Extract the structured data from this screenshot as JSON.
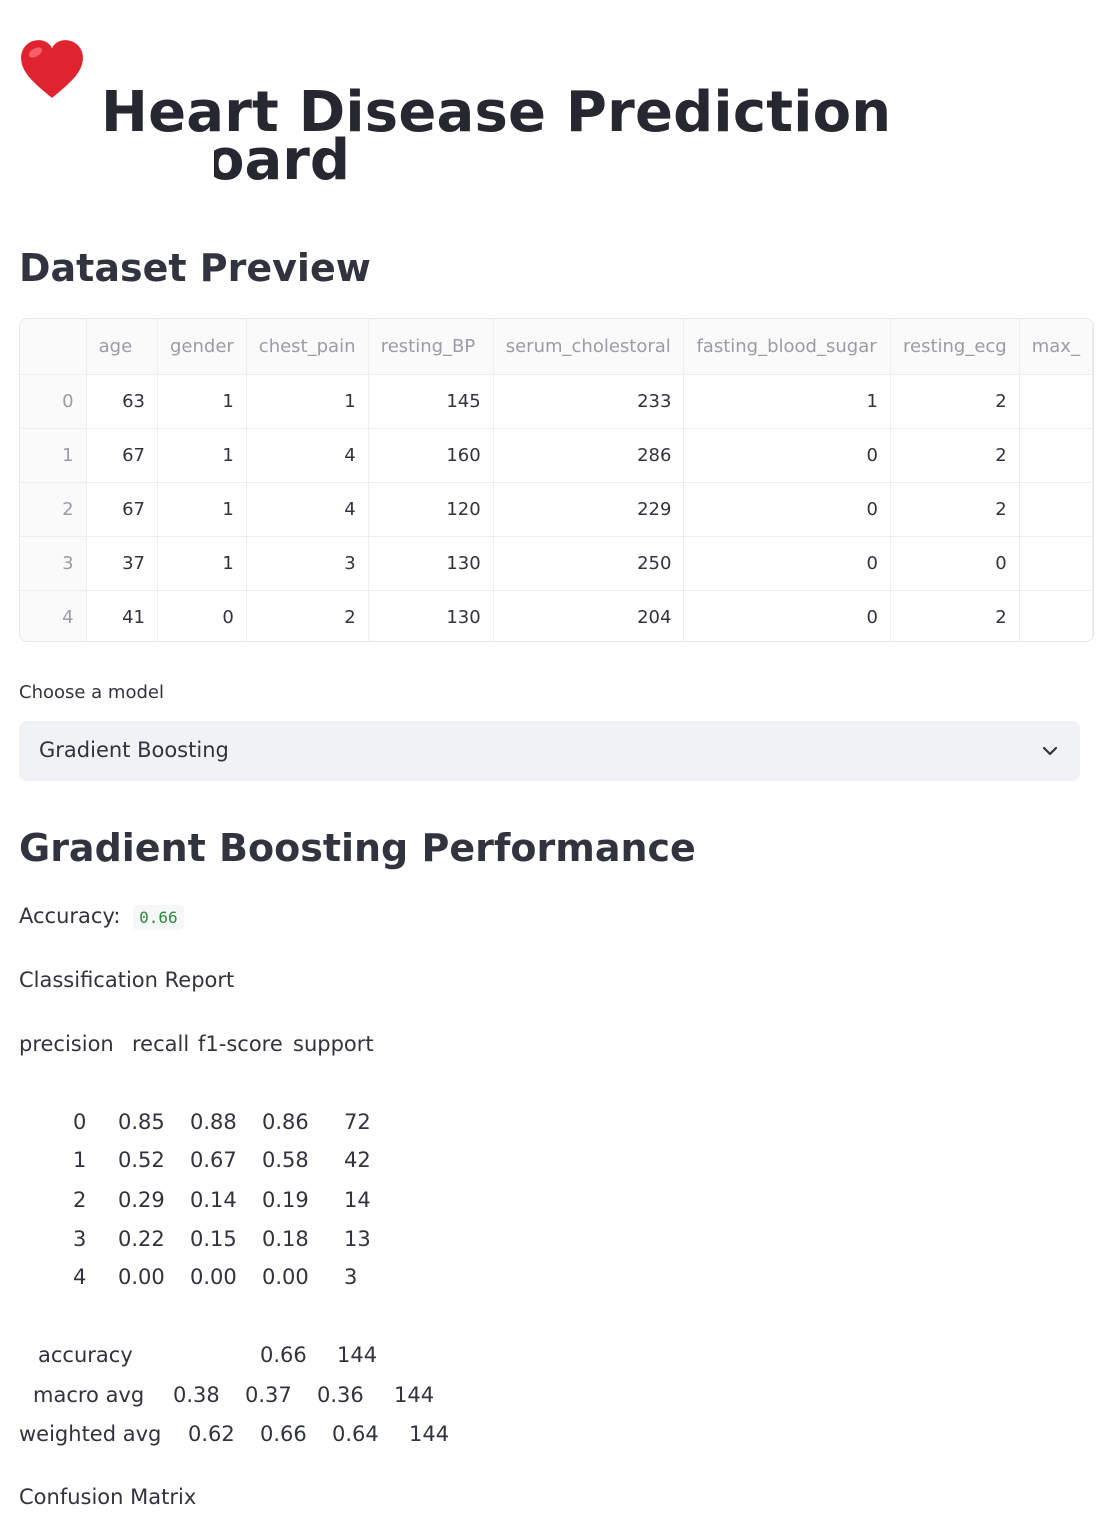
{
  "title": "Heart Disease Prediction Dashboard",
  "title_line1": "Heart Disease Prediction",
  "title_line2": "Dashboard",
  "heart_icon": "red-heart-emoji",
  "dataset_heading": "Dataset Preview",
  "table": {
    "columns": [
      "",
      "age",
      "gender",
      "chest_pain",
      "resting_BP",
      "serum_cholestoral",
      "fasting_blood_sugar",
      "resting_ecg",
      "max_"
    ],
    "rows": [
      [
        "0",
        "63",
        "1",
        "1",
        "145",
        "233",
        "1",
        "2",
        ""
      ],
      [
        "1",
        "67",
        "1",
        "4",
        "160",
        "286",
        "0",
        "2",
        ""
      ],
      [
        "2",
        "67",
        "1",
        "4",
        "120",
        "229",
        "0",
        "2",
        ""
      ],
      [
        "3",
        "37",
        "1",
        "3",
        "130",
        "250",
        "0",
        "0",
        ""
      ],
      [
        "4",
        "41",
        "0",
        "2",
        "130",
        "204",
        "0",
        "2",
        ""
      ]
    ]
  },
  "model_select": {
    "label": "Choose a model",
    "value": "Gradient Boosting",
    "icon": "chevron-down-icon"
  },
  "performance_heading": "Gradient Boosting Performance",
  "accuracy_label": "Accuracy:",
  "accuracy_value": "0.66",
  "classification_report_label": "Classification Report",
  "report": {
    "header": [
      "precision",
      "recall",
      "f1-score",
      "support"
    ],
    "rows": [
      [
        "0",
        "0.85",
        "0.88",
        "0.86",
        "72"
      ],
      [
        "1",
        "0.52",
        "0.67",
        "0.58",
        "42"
      ],
      [
        "2",
        "0.29",
        "0.14",
        "0.19",
        "14"
      ],
      [
        "3",
        "0.22",
        "0.15",
        "0.18",
        "13"
      ],
      [
        "4",
        "0.00",
        "0.00",
        "0.00",
        "3"
      ]
    ],
    "accuracy_row": [
      "accuracy",
      "0.66",
      "144"
    ],
    "macro_row": [
      "macro avg",
      "0.38",
      "0.37",
      "0.36",
      "144"
    ],
    "weighted_row": [
      "weighted avg",
      "0.62",
      "0.66",
      "0.64",
      "144"
    ]
  },
  "confusion_matrix_label": "Confusion Matrix"
}
